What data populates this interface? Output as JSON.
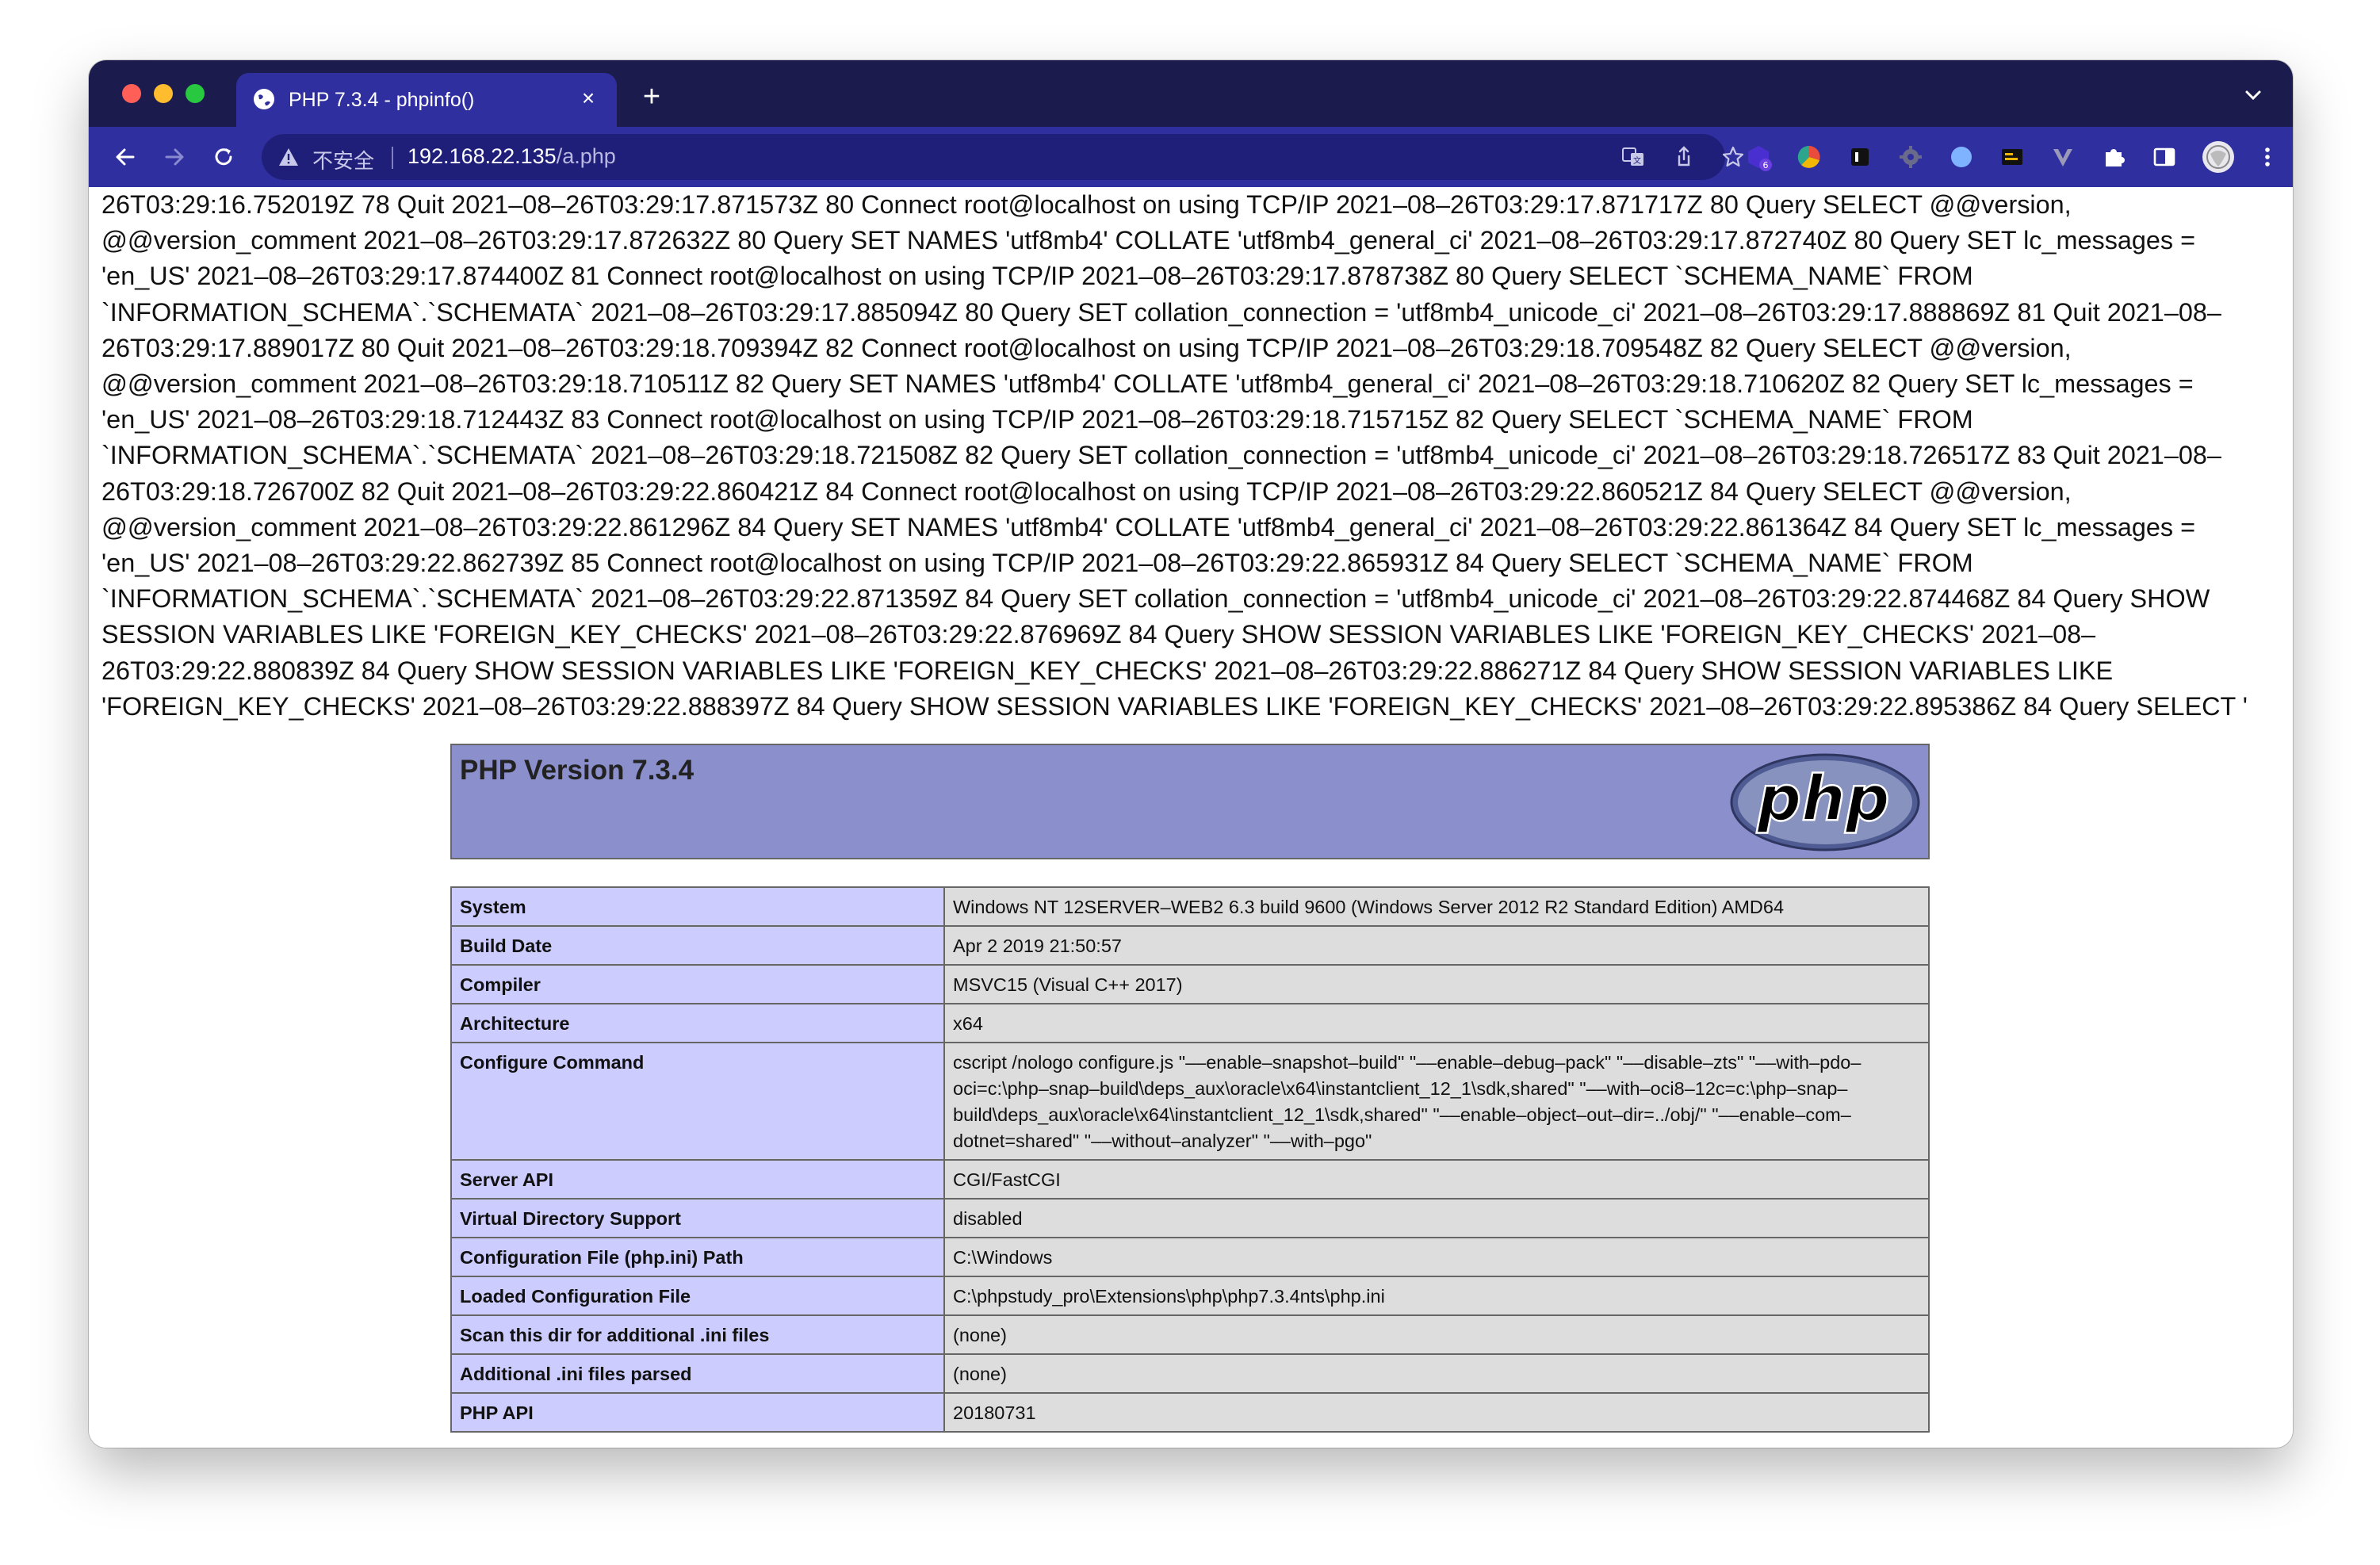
{
  "tab": {
    "title": "PHP 7.3.4 - phpinfo()",
    "close": "×",
    "new_tab": "+"
  },
  "address_bar": {
    "security_label": "不安全",
    "url_host": "192.168.22.135",
    "url_path": "/a.php"
  },
  "icons": {
    "back": "arrow-left-icon",
    "forward": "arrow-right-icon",
    "reload": "reload-icon",
    "warning": "warning-icon",
    "translate": "translate-icon",
    "share": "share-icon",
    "bookmark": "star-icon",
    "extensions": "puzzle-icon",
    "side_panel": "side-panel-icon",
    "profile": "avatar",
    "menu": "more-vertical-icon",
    "tab_search": "chevron-down-icon"
  },
  "extension_badge": "6",
  "log": {
    "text": "26T03:29:16.752019Z 78 Quit 2021–08–26T03:29:17.871573Z 80 Connect root@localhost on using TCP/IP 2021–08–26T03:29:17.871717Z 80 Query SELECT @@version, @@version_comment 2021–08–26T03:29:17.872632Z 80 Query SET NAMES 'utf8mb4' COLLATE 'utf8mb4_general_ci' 2021–08–26T03:29:17.872740Z 80 Query SET lc_messages = 'en_US' 2021–08–26T03:29:17.874400Z 81 Connect root@localhost on using TCP/IP 2021–08–26T03:29:17.878738Z 80 Query SELECT `SCHEMA_NAME` FROM `INFORMATION_SCHEMA`.`SCHEMATA` 2021–08–26T03:29:17.885094Z 80 Query SET collation_connection = 'utf8mb4_unicode_ci' 2021–08–26T03:29:17.888869Z 81 Quit 2021–08–26T03:29:17.889017Z 80 Quit 2021–08–26T03:29:18.709394Z 82 Connect root@localhost on using TCP/IP 2021–08–26T03:29:18.709548Z 82 Query SELECT @@version, @@version_comment 2021–08–26T03:29:18.710511Z 82 Query SET NAMES 'utf8mb4' COLLATE 'utf8mb4_general_ci' 2021–08–26T03:29:18.710620Z 82 Query SET lc_messages = 'en_US' 2021–08–26T03:29:18.712443Z 83 Connect root@localhost on using TCP/IP 2021–08–26T03:29:18.715715Z 82 Query SELECT `SCHEMA_NAME` FROM `INFORMATION_SCHEMA`.`SCHEMATA` 2021–08–26T03:29:18.721508Z 82 Query SET collation_connection = 'utf8mb4_unicode_ci' 2021–08–26T03:29:18.726517Z 83 Quit 2021–08–26T03:29:18.726700Z 82 Quit 2021–08–26T03:29:22.860421Z 84 Connect root@localhost on using TCP/IP 2021–08–26T03:29:22.860521Z 84 Query SELECT @@version, @@version_comment 2021–08–26T03:29:22.861296Z 84 Query SET NAMES 'utf8mb4' COLLATE 'utf8mb4_general_ci' 2021–08–26T03:29:22.861364Z 84 Query SET lc_messages = 'en_US' 2021–08–26T03:29:22.862739Z 85 Connect root@localhost on using TCP/IP 2021–08–26T03:29:22.865931Z 84 Query SELECT `SCHEMA_NAME` FROM `INFORMATION_SCHEMA`.`SCHEMATA` 2021–08–26T03:29:22.871359Z 84 Query SET collation_connection = 'utf8mb4_unicode_ci' 2021–08–26T03:29:22.874468Z 84 Query SHOW SESSION VARIABLES LIKE 'FOREIGN_KEY_CHECKS' 2021–08–26T03:29:22.876969Z 84 Query SHOW SESSION VARIABLES LIKE 'FOREIGN_KEY_CHECKS' 2021–08–26T03:29:22.880839Z 84 Query SHOW SESSION VARIABLES LIKE 'FOREIGN_KEY_CHECKS' 2021–08–26T03:29:22.886271Z 84 Query SHOW SESSION VARIABLES LIKE 'FOREIGN_KEY_CHECKS' 2021–08–26T03:29:22.888397Z 84 Query SHOW SESSION VARIABLES LIKE 'FOREIGN_KEY_CHECKS' 2021–08–26T03:29:22.895386Z 84 Query SELECT '"
  },
  "phpinfo": {
    "version_title": "PHP Version 7.3.4",
    "logo_text": "php",
    "rows": [
      {
        "key": "System",
        "value": "Windows NT 12SERVER–WEB2 6.3 build 9600 (Windows Server 2012 R2 Standard Edition) AMD64"
      },
      {
        "key": "Build Date",
        "value": "Apr 2 2019 21:50:57"
      },
      {
        "key": "Compiler",
        "value": "MSVC15 (Visual C++ 2017)"
      },
      {
        "key": "Architecture",
        "value": "x64"
      },
      {
        "key": "Configure Command",
        "value": "cscript /nologo configure.js \"––enable–snapshot–build\" \"––enable–debug–pack\" \"––disable–zts\" \"––with–pdo–oci=c:\\php–snap–build\\deps_aux\\oracle\\x64\\instantclient_12_1\\sdk,shared\" \"––with–oci8–12c=c:\\php–snap–build\\deps_aux\\oracle\\x64\\instantclient_12_1\\sdk,shared\" \"––enable–object–out–dir=../obj/\" \"––enable–com–dotnet=shared\" \"––without–analyzer\" \"––with–pgo\""
      },
      {
        "key": "Server API",
        "value": "CGI/FastCGI"
      },
      {
        "key": "Virtual Directory Support",
        "value": "disabled"
      },
      {
        "key": "Configuration File (php.ini) Path",
        "value": "C:\\Windows"
      },
      {
        "key": "Loaded Configuration File",
        "value": "C:\\phpstudy_pro\\Extensions\\php\\php7.3.4nts\\php.ini"
      },
      {
        "key": "Scan this dir for additional .ini files",
        "value": "(none)"
      },
      {
        "key": "Additional .ini files parsed",
        "value": "(none)"
      },
      {
        "key": "PHP API",
        "value": "20180731"
      }
    ]
  },
  "colors": {
    "tabstrip": "#1c1b4d",
    "toolbar": "#2f2fa0",
    "php_header": "#8b8fcc",
    "php_key_cell": "#ccccff",
    "php_value_cell": "#dddddd"
  }
}
